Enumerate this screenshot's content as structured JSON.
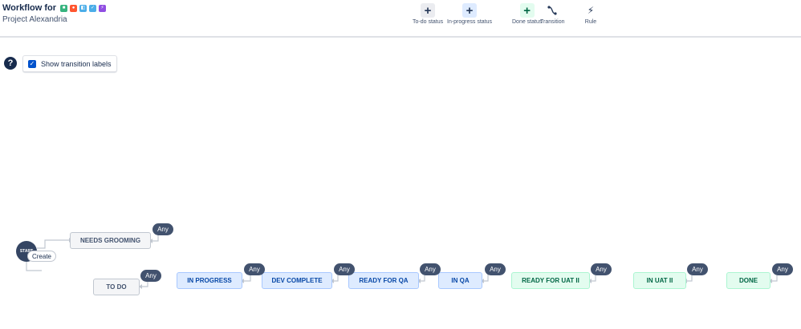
{
  "header": {
    "title": "Workflow for",
    "project": "Project Alexandria",
    "issue_type_icons": [
      {
        "name": "story-type-icon",
        "color": "#36b37e",
        "glyph": "■"
      },
      {
        "name": "bug-type-icon",
        "color": "#ff5630",
        "glyph": "●"
      },
      {
        "name": "subtask-type-icon",
        "color": "#4bade8",
        "glyph": "◧"
      },
      {
        "name": "task-type-icon",
        "color": "#4bade8",
        "glyph": "✓"
      },
      {
        "name": "epic-type-icon",
        "color": "#904ee2",
        "glyph": "⚡"
      }
    ]
  },
  "toolbar": {
    "todo_status": "To-do status",
    "inprogress_status": "In-progress status",
    "done_status": "Done status",
    "transition": "Transition",
    "rule": "Rule"
  },
  "controls": {
    "help": "?",
    "show_transition_labels": "Show transition labels",
    "show_transition_labels_checked": true
  },
  "diagram": {
    "start_label": "START",
    "create_label": "Create",
    "any_label": "Any",
    "statuses": {
      "needs_grooming": "NEEDS GROOMING",
      "to_do": "TO DO",
      "in_progress": "IN PROGRESS",
      "dev_complete": "DEV COMPLETE",
      "ready_for_qa": "READY FOR QA",
      "in_qa": "IN QA",
      "ready_for_uat_ii": "READY FOR UAT II",
      "in_uat_ii": "IN UAT II",
      "done": "DONE"
    }
  },
  "colors": {
    "todo": "#f4f5f7",
    "inprogress": "#deebff",
    "done": "#e3fcef",
    "accent": "#0052cc",
    "any_badge": "#42526e"
  }
}
